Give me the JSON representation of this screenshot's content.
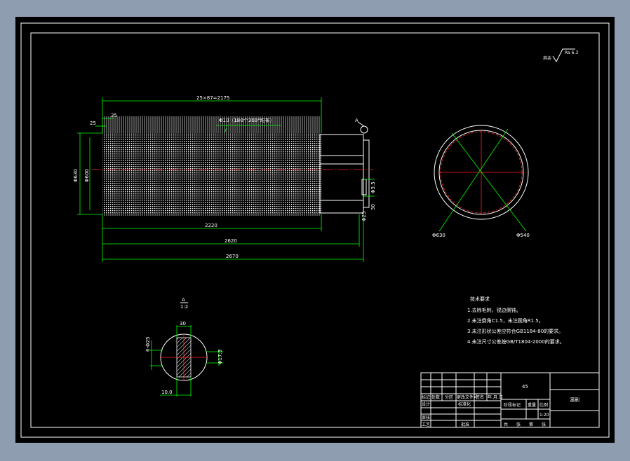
{
  "main_view": {
    "dim_top_pitch": "25×87=2175",
    "dim_top_35": "35",
    "dim_top_25": "25",
    "dim_left_outer": "Φ630",
    "dim_left_inner": "Φ600",
    "bristle_note": "Φ10（180个360°均布）",
    "dim_bottom_2220": "2220",
    "dim_bottom_2620": "2620",
    "dim_bottom_2670": "2670",
    "section_mark": "A",
    "right_dim_1": "Φ3.5",
    "right_dim_2": "30",
    "right_dim_3": "Φ25"
  },
  "end_view": {
    "dim_outer": "Φ630",
    "dim_inner": "Φ540"
  },
  "section_view": {
    "label_letter": "A",
    "label_scale": "1:2",
    "dim_top": "30",
    "dim_left": "6-Φ25",
    "dim_right": "Φ17.5",
    "dim_bottom": "10.0"
  },
  "roughness": {
    "label": "其余",
    "value": "Ra 6.3"
  },
  "tech_requirements": {
    "title": "技术要求",
    "items": [
      "1.去除毛刺，锐边倒钝。",
      "2.未注倒角C1.5，未注圆角R1.5。",
      "3.未注形状公差应符合GB1184-80的要求。",
      "4.未注尺寸公差按GB/T1804-2000的要求。"
    ]
  },
  "title_block": {
    "material": "45",
    "part_name": "滚刷",
    "scale": "1:20",
    "r_biaoji": "标记",
    "r_chushu": "处数",
    "r_fenqu": "分区",
    "r_gengai": "更改文件号",
    "r_qianming": "签名",
    "r_date": "年.月.日",
    "r_sheji": "设计",
    "r_biaozhunhua": "标准化",
    "r_shenhe": "审核",
    "r_gongyi": "工艺",
    "r_pizhun": "批准",
    "r_jieduan": "阶段标记",
    "r_zhongliang": "重量",
    "r_bili": "比例",
    "r_gong": "共",
    "r_zhang": "张",
    "r_di": "第"
  }
}
